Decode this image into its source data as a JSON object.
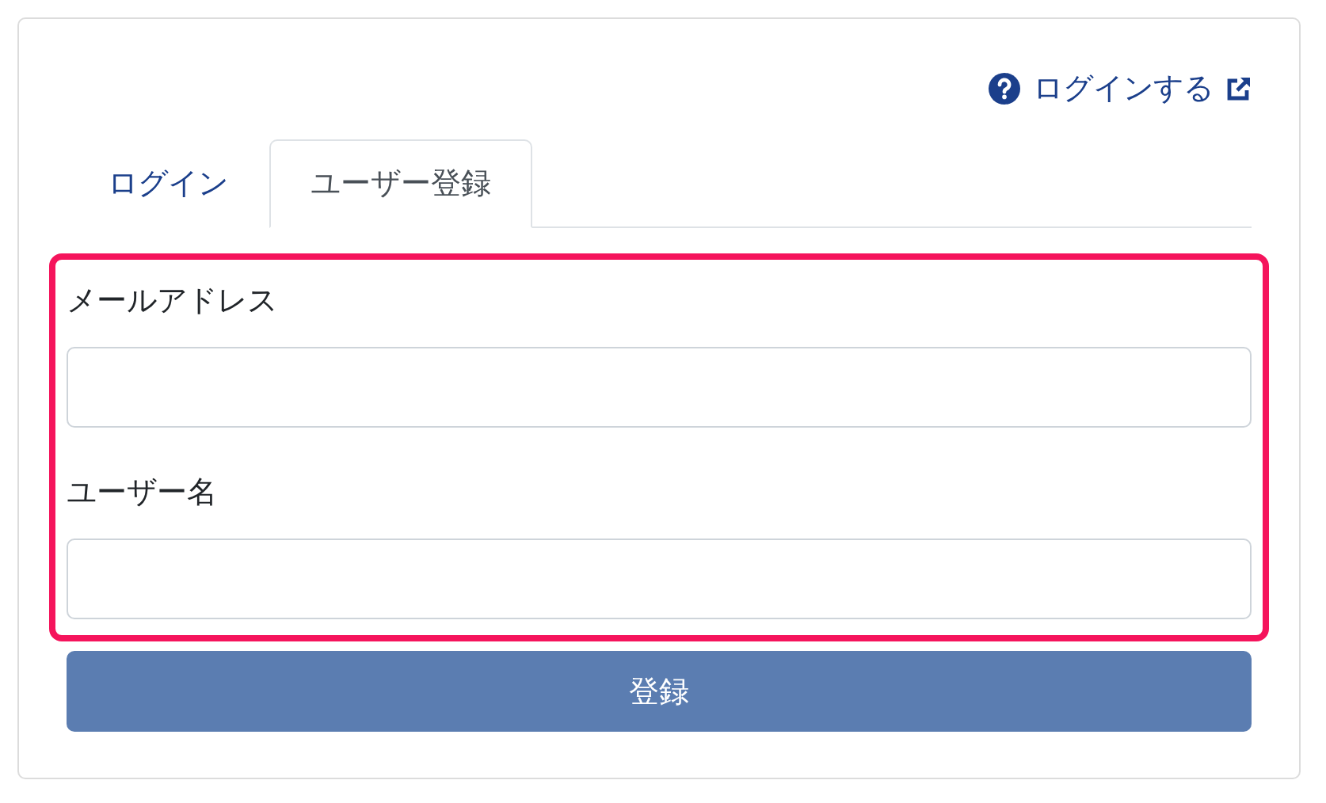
{
  "help_link": {
    "text": "ログインする"
  },
  "tabs": [
    {
      "label": "ログイン",
      "selected": false
    },
    {
      "label": "ユーザー登録",
      "selected": true
    }
  ],
  "form": {
    "highlighted": true,
    "fields": [
      {
        "label": "メールアドレス"
      },
      {
        "label": "ユーザー名"
      }
    ]
  },
  "submit_button": {
    "label": "登録",
    "disabled": true
  }
}
